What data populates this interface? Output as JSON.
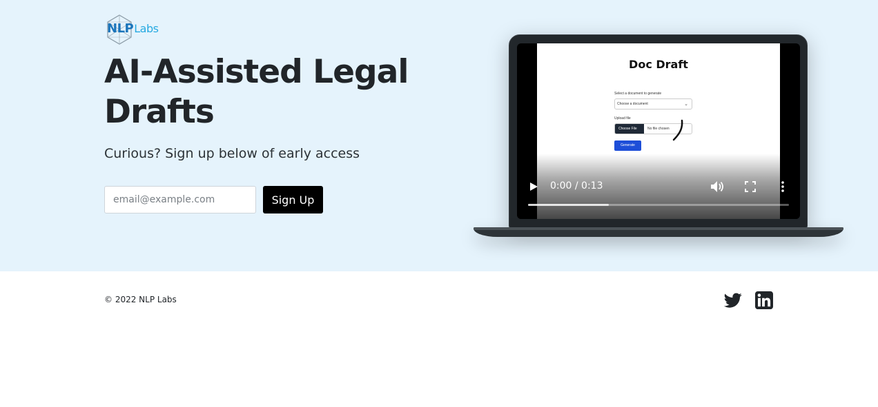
{
  "brand": {
    "logo_nlp": "NLP",
    "logo_labs": "Labs"
  },
  "hero": {
    "headline": "AI-Assisted Legal Drafts",
    "subheading": "Curious? Sign up below of early access",
    "email_placeholder": "email@example.com",
    "signup_label": "Sign Up"
  },
  "video": {
    "app_title": "Doc Draft",
    "select_label": "Select a document to generate",
    "select_value": "Choose a document",
    "upload_label": "Upload file",
    "choose_file_label": "Choose File",
    "no_file_label": "No file chosen",
    "generate_label": "Generate",
    "time_display": "0:00 / 0:13",
    "buffered_fraction": 0.31
  },
  "footer": {
    "copyright": "© 2022 NLP Labs",
    "social_icons": [
      "twitter-icon",
      "linkedin-icon"
    ]
  },
  "colors": {
    "hero_bg": "#e5f3fc",
    "button_bg": "#000000",
    "text": "#212529",
    "logo_primary": "#1b75bb",
    "logo_secondary": "#27aae1",
    "generate_button": "#1d4ed8"
  }
}
